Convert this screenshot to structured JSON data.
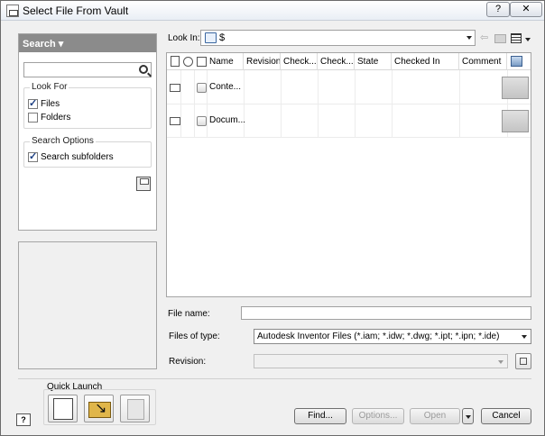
{
  "window": {
    "title": "Select File From Vault",
    "help_label": "?",
    "close_label": "✕"
  },
  "search_panel": {
    "header": "Search ▾",
    "look_for": {
      "title": "Look For",
      "options": [
        {
          "label": "Files",
          "checked": true
        },
        {
          "label": "Folders",
          "checked": false
        }
      ]
    },
    "search_options": {
      "title": "Search Options",
      "options": [
        {
          "label": "Search subfolders",
          "checked": true
        }
      ]
    }
  },
  "look_in": {
    "label": "Look In:",
    "value": "$"
  },
  "file_list": {
    "columns": [
      "Name",
      "Revision",
      "Check...",
      "Check...",
      "State",
      "Checked In",
      "Comment"
    ],
    "rows": [
      {
        "name": "Conte..."
      },
      {
        "name": "Docum..."
      }
    ]
  },
  "fields": {
    "file_name_label": "File name:",
    "file_name_value": "",
    "files_of_type_label": "Files of type:",
    "files_of_type_value": "Autodesk Inventor Files (*.iam; *.idw; *.dwg; *.ipt; *.ipn; *.ide)",
    "revision_label": "Revision:"
  },
  "quick_launch": {
    "label": "Quick Launch"
  },
  "buttons": {
    "help": "?",
    "find": "Find...",
    "options": "Options...",
    "open": "Open",
    "cancel": "Cancel"
  }
}
